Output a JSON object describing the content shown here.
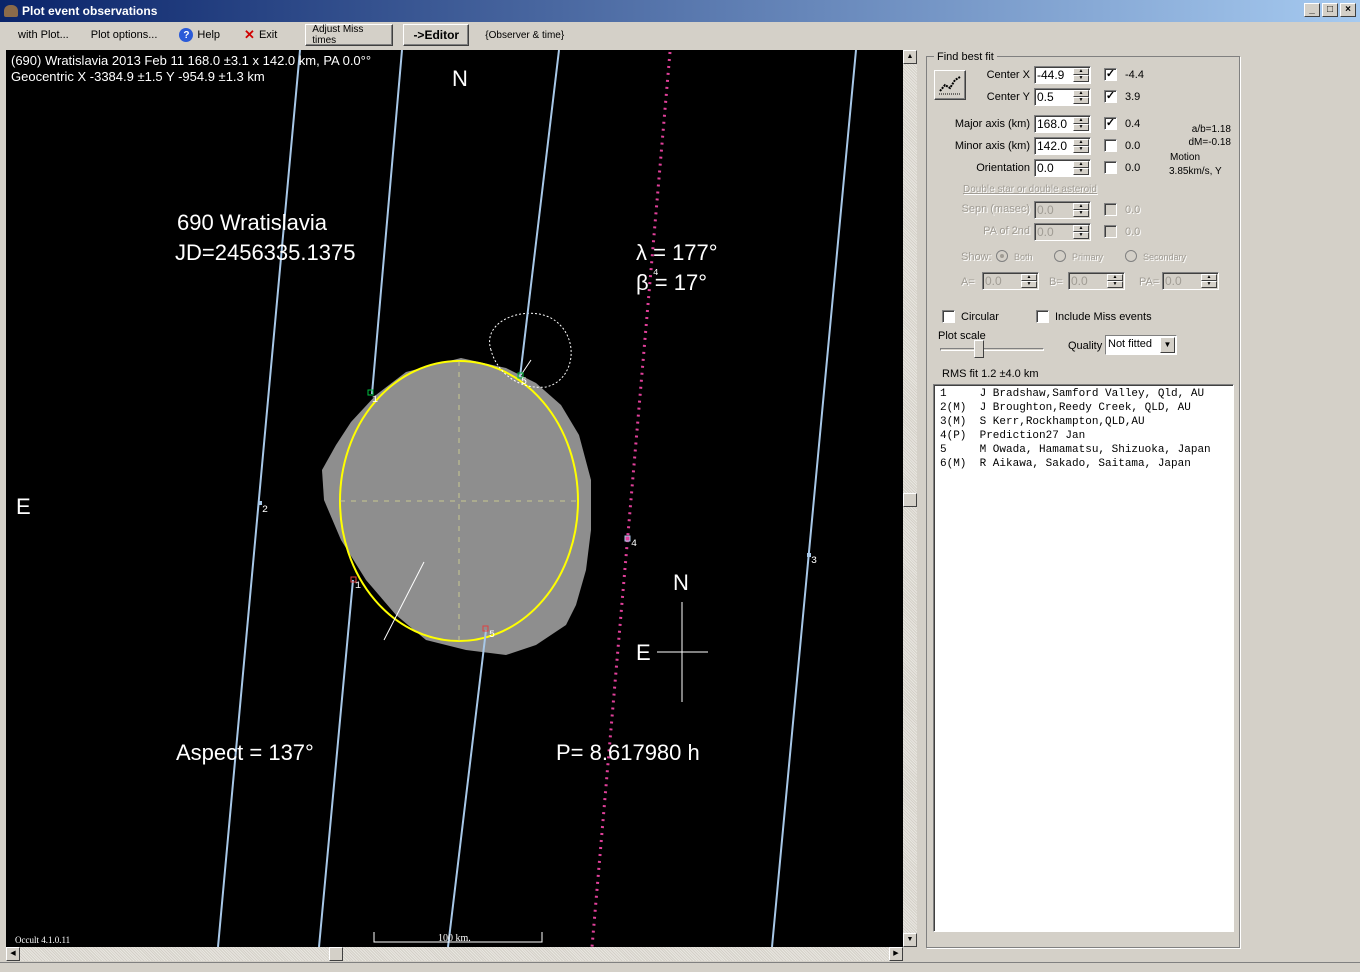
{
  "window": {
    "title": "Plot event observations",
    "buttons": {
      "minimize": "_",
      "maximize": "□",
      "close": "×"
    }
  },
  "menu": {
    "with_plot": "with Plot...",
    "plot_options": "Plot options...",
    "help": "Help",
    "exit": "Exit",
    "adjust_miss_times": "Adjust Miss times",
    "editor": "->Editor",
    "observer_time": "{Observer & time}"
  },
  "plot": {
    "header_line1": "(690) Wratislavia  2013 Feb 11   168.0 ±3.1 x 142.0 km, PA 0.0°°",
    "header_line2": "Geocentric X -3384.9 ±1.5  Y -954.9 ±1.3 km",
    "north_label": "N",
    "east_label": "E",
    "asteroid_name": "690 Wratislavia",
    "jd": "JD=2456335.1375",
    "lambda": "λ =  177°",
    "beta": "β =   17°",
    "aspect": "Aspect = 137°",
    "period": "P= 8.617980 h",
    "compass_n": "N",
    "compass_e": "E",
    "scale_label": "100 km.",
    "version": "Occult 4.1.0.11",
    "chord_labels": [
      "1",
      "2",
      "3",
      "4",
      "5"
    ],
    "colors": {
      "background": "#000000",
      "chord": "#a8c8e8",
      "prediction": "#e0409a",
      "fit_ellipse": "#ffff00",
      "shape_model": "#909090",
      "disappear": "#00c040",
      "reappear": "#e04040"
    }
  },
  "fit_panel": {
    "group_label": "Find best fit",
    "center_x": {
      "label": "Center X",
      "value": "-44.9",
      "checked": true,
      "delta": "-4.4"
    },
    "center_y": {
      "label": "Center Y",
      "value": "0.5",
      "checked": true,
      "delta": "3.9"
    },
    "major_axis": {
      "label": "Major axis (km)",
      "value": "168.0",
      "checked": true,
      "delta": "0.4"
    },
    "minor_axis": {
      "label": "Minor axis (km)",
      "value": "142.0",
      "checked": false,
      "delta": "0.0"
    },
    "orientation": {
      "label": "Orientation",
      "value": "0.0",
      "checked": false,
      "delta": "0.0"
    },
    "ab_ratio": "a/b=1.18",
    "dm": "dM=-0.18",
    "motion_label": "Motion",
    "motion_value": "3.85km/s, Y",
    "double_label": "Double star  or  double asteroid",
    "sepn": {
      "label": "Sepn (masec)",
      "value": "0.0",
      "delta": "0.0"
    },
    "pa2nd": {
      "label": "PA of 2nd",
      "value": "0.0",
      "delta": "0.0"
    },
    "show_label": "Show:",
    "show_options": [
      "Both",
      "Primary",
      "Secondary"
    ],
    "show_selected": "Both",
    "a_label": "A=",
    "a_value": "0.0",
    "b_label": "B=",
    "b_value": "0.0",
    "pa_label": "PA=",
    "pa_value": "0.0",
    "circular_label": "Circular",
    "include_miss_label": "Include Miss events",
    "plot_scale_label": "Plot scale",
    "plot_scale_fraction": 0.35,
    "quality_label": "Quality",
    "quality_value": "Not fitted",
    "rms_fit": "RMS fit 1.2 ±4.0 km"
  },
  "observers": [
    "1     J Bradshaw,Samford Valley, Qld, AU",
    "2(M)  J Broughton,Reedy Creek, QLD, AU",
    "3(M)  S Kerr,Rockhampton,QLD,AU",
    "4(P)  Prediction27 Jan",
    "5     M Owada, Hamamatsu, Shizuoka, Japan",
    "6(M)  R Aikawa, Sakado, Saitama, Japan"
  ]
}
